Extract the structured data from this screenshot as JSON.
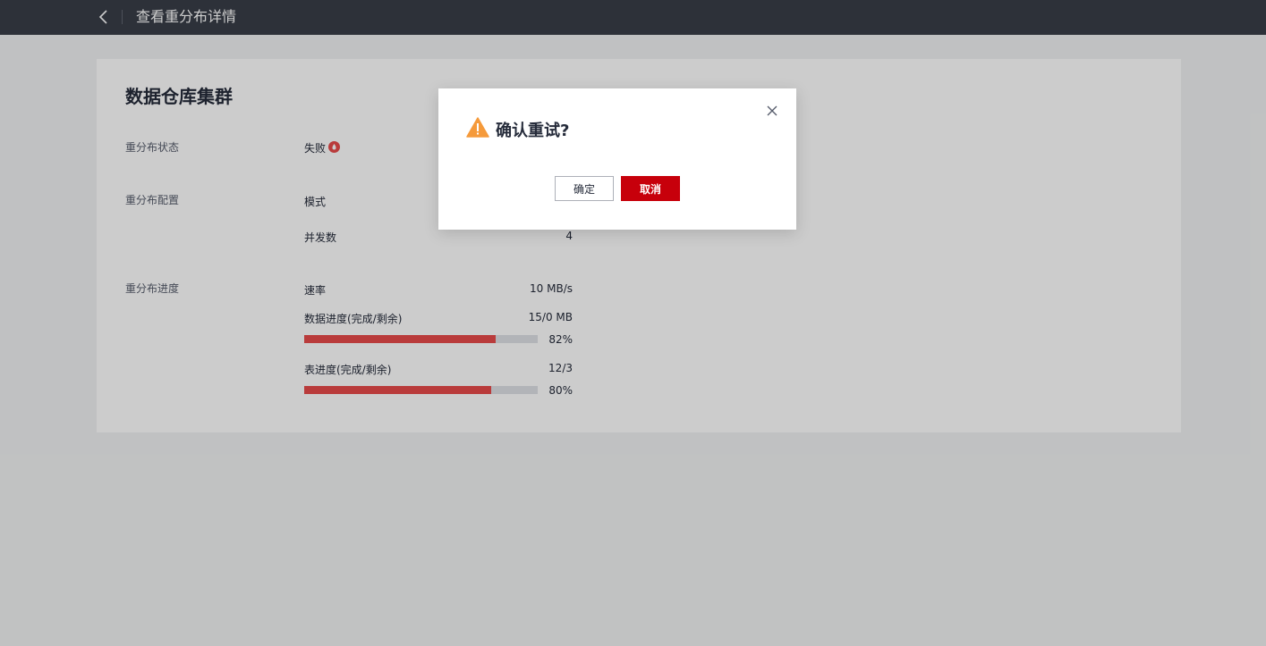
{
  "header": {
    "title": "查看重分布详情",
    "back_icon": "chevron-left-icon"
  },
  "card": {
    "title": "数据仓库集群",
    "status": {
      "label": "重分布状态",
      "value": "失败",
      "icon": "failed-info-icon",
      "icon_color": "#e84a4a"
    },
    "config": {
      "label": "重分布配置",
      "mode_label": "模式",
      "concurrency_label": "并发数",
      "concurrency_value": "4"
    },
    "progress": {
      "label": "重分布进度",
      "rate_label": "速率",
      "rate_value": "10 MB/s",
      "data_label": "数据进度(完成/剩余)",
      "data_value": "15/0 MB",
      "data_percent_text": "82%",
      "data_percent": 0.82,
      "table_label": "表进度(完成/剩余)",
      "table_value": "12/3",
      "table_percent_text": "80%",
      "table_percent": 0.8,
      "bar_color": "#e84a4a"
    }
  },
  "dialog": {
    "title": "确认重试?",
    "warning_icon": "warning-triangle-icon",
    "warning_color": "#f59a3b",
    "ok_label": "确定",
    "cancel_label": "取消",
    "accent_color": "#c7000b"
  }
}
